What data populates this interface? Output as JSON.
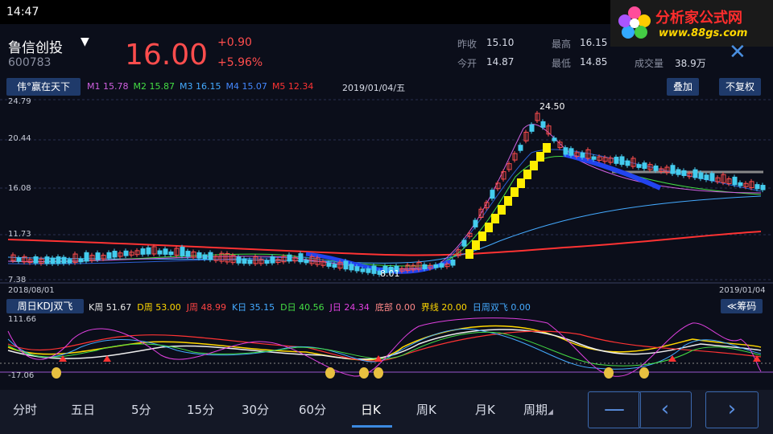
{
  "status": {
    "time": "14:47"
  },
  "logo": {
    "name": "分析家公式网",
    "url": "www.88gs.com"
  },
  "stock": {
    "name": "鲁信创投",
    "code": "600783",
    "price": "16.00",
    "change": "+0.90",
    "change_pct": "+5.96%"
  },
  "quote": {
    "prev_close_label": "昨收",
    "prev_close": "15.10",
    "open_label": "今开",
    "open": "14.87",
    "high_label": "最高",
    "high": "16.15",
    "low_label": "最低",
    "low": "14.85",
    "volume_label": "成交量",
    "volume": "38.9万"
  },
  "indicator_main": {
    "name": "伟°赢在天下",
    "ma": [
      {
        "label": "M1",
        "value": "15.78",
        "color": "#d060e0"
      },
      {
        "label": "M2",
        "value": "15.87",
        "color": "#44dd44"
      },
      {
        "label": "M3",
        "value": "16.15",
        "color": "#44aaff"
      },
      {
        "label": "M4",
        "value": "15.07",
        "color": "#4488ff"
      },
      {
        "label": "M5",
        "value": "12.34",
        "color": "#ff3333"
      }
    ],
    "date": "2019/01/04/五",
    "overlay_button": "叠加",
    "adjust_button": "不复权"
  },
  "chart_data": {
    "type": "candlestick",
    "y_ticks": [
      "24.79",
      "20.44",
      "16.08",
      "11.73",
      "7.38"
    ],
    "x_start": "2018/08/01",
    "x_end": "2019/01/04",
    "annotations": {
      "high": "24.50",
      "low": "8.01"
    }
  },
  "indicator_kdj": {
    "name": "周日KDJ双飞",
    "items": [
      {
        "label": "K周",
        "value": "51.67",
        "color": "#e8e8e8"
      },
      {
        "label": "D周",
        "value": "53.00",
        "color": "#ffd700"
      },
      {
        "label": "J周",
        "value": "48.99",
        "color": "#ff4444"
      },
      {
        "label": "K日",
        "value": "35.15",
        "color": "#44aaff"
      },
      {
        "label": "D日",
        "value": "40.56",
        "color": "#44dd44"
      },
      {
        "label": "J日",
        "value": "24.34",
        "color": "#e040e0"
      },
      {
        "label": "底部",
        "value": "0.00",
        "color": "#ff8888"
      },
      {
        "label": "界线",
        "value": "20.00",
        "color": "#ffd700"
      },
      {
        "label": "日周双飞",
        "value": "0.00",
        "color": "#44aaff"
      }
    ],
    "y_top": "111.66",
    "y_bottom": "-17.06",
    "chips_button": "≪筹码"
  },
  "bottom_tabs": [
    "分时",
    "五日",
    "5分",
    "15分",
    "30分",
    "60分",
    "日K",
    "周K",
    "月K",
    "周期"
  ],
  "active_tab": "日K",
  "nav": {
    "minus": "—",
    "prev": "‹",
    "next": "›"
  }
}
